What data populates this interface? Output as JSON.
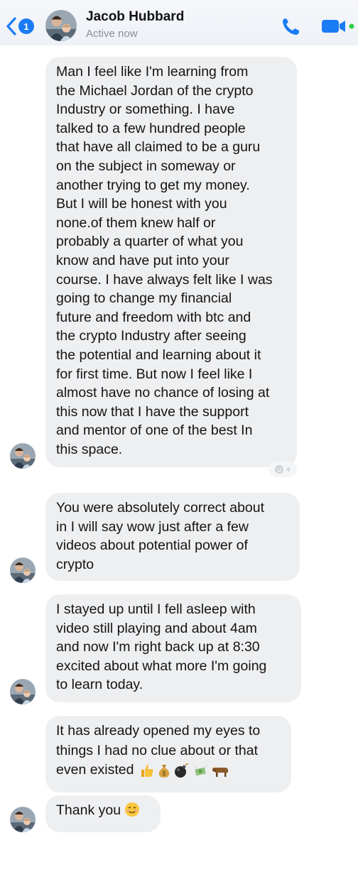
{
  "header": {
    "back_badge": "1",
    "contact_name": "Jacob Hubbard",
    "status": "Active now"
  },
  "messages": [
    {
      "lines": [
        "Man I feel like I'm learning from",
        "the Michael Jordan of the crypto",
        "Industry or something. I have",
        "talked to a few hundred people",
        "that have all claimed to be a guru",
        "on the subject in someway or",
        "another trying to get my money.",
        "But I will be honest with you",
        "none.of them knew half or",
        "probably a quarter of what you",
        "know and have put into your",
        "course. I have always felt like I was",
        "going to change my financial",
        "future and freedom with btc and",
        "the crypto Industry after seeing",
        "the potential and learning about it",
        "for first time. But now I feel like I",
        "almost have no chance of losing at",
        "this now that I have the support",
        "and mentor of one of the best In",
        "this space."
      ]
    },
    {
      "lines": [
        "You were absolutely correct about",
        "in I will say wow just after a few",
        "videos about potential power of",
        "crypto"
      ]
    },
    {
      "lines": [
        "I stayed up until I fell asleep with",
        "video still playing and about 4am",
        "and now I'm right back up at 8:30",
        "excited about what more I'm going",
        "to learn today."
      ]
    },
    {
      "lines": [
        "It has already opened my eyes to",
        "things I had no clue about or that",
        "even existed"
      ],
      "emojis": [
        "thumbs-up-icon",
        "money-bag-icon",
        "bomb-icon",
        "money-with-wings-icon",
        "ox-icon"
      ]
    },
    {
      "lines": [
        "Thank you"
      ],
      "emojis": [
        "smiling-face-icon"
      ]
    }
  ],
  "colors": {
    "accent": "#1a7cf5",
    "bubble": "#eeeff1",
    "video_dot": "#2ecc40"
  }
}
